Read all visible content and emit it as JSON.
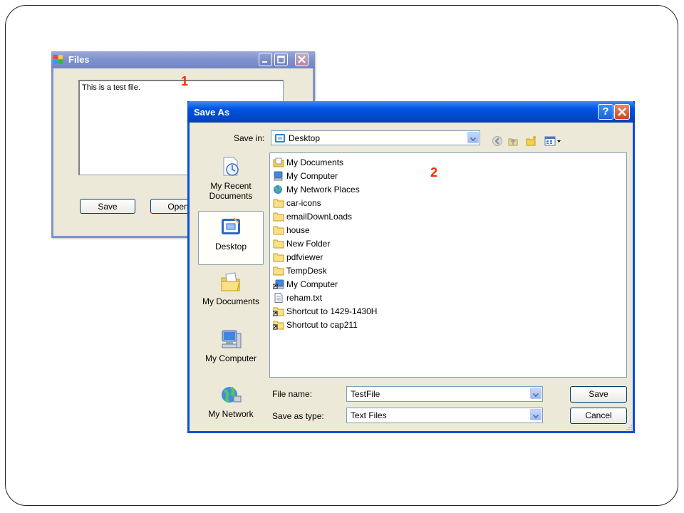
{
  "files_window": {
    "title": "Files",
    "text_content": "This is a test file.",
    "save_button": "Save",
    "open_button": "Open"
  },
  "markers": {
    "one": "1",
    "two": "2"
  },
  "save_dialog": {
    "title": "Save As",
    "help_button": "?",
    "save_in_label": "Save in:",
    "save_in_value": "Desktop",
    "places": [
      {
        "label": "My Recent Documents"
      },
      {
        "label": "Desktop"
      },
      {
        "label": "My Documents"
      },
      {
        "label": "My Computer"
      },
      {
        "label": "My Network"
      }
    ],
    "files": [
      {
        "name": "My Documents",
        "icon": "my-documents-icon"
      },
      {
        "name": "My Computer",
        "icon": "my-computer-icon"
      },
      {
        "name": "My Network Places",
        "icon": "network-places-icon"
      },
      {
        "name": "car-icons",
        "icon": "folder-icon"
      },
      {
        "name": "emailDownLoads",
        "icon": "folder-icon"
      },
      {
        "name": "house",
        "icon": "folder-icon"
      },
      {
        "name": "New Folder",
        "icon": "folder-icon"
      },
      {
        "name": "pdfviewer",
        "icon": "folder-icon"
      },
      {
        "name": "TempDesk",
        "icon": "folder-icon"
      },
      {
        "name": "My Computer",
        "icon": "computer-shortcut-icon"
      },
      {
        "name": "reham.txt",
        "icon": "text-file-icon"
      },
      {
        "name": "Shortcut to 1429-1430H",
        "icon": "folder-shortcut-icon"
      },
      {
        "name": "Shortcut to cap211",
        "icon": "folder-shortcut-icon"
      }
    ],
    "file_name_label": "File name:",
    "file_name_value": "TestFile",
    "save_type_label": "Save as type:",
    "save_type_value": "Text Files",
    "save_button": "Save",
    "cancel_button": "Cancel"
  },
  "colors": {
    "xp_title_blue": "#0054e3",
    "inactive_title": "#7f93cd",
    "dialog_face": "#ece9d8",
    "marker_red": "#ff2a00"
  }
}
